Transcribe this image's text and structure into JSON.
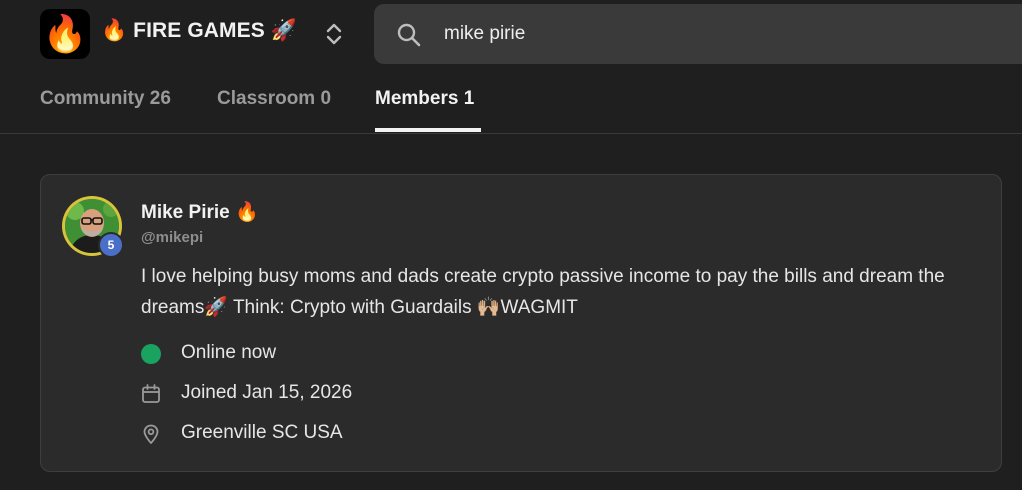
{
  "header": {
    "logo_emoji": "🔥",
    "group_name": "🔥 FIRE GAMES 🚀",
    "switcher_icon": "chevron-up-down-icon"
  },
  "search": {
    "value": "mike pirie",
    "icon": "search-icon"
  },
  "tabs": [
    {
      "label": "Community 26",
      "active": false
    },
    {
      "label": "Classroom 0",
      "active": false
    },
    {
      "label": "Members 1",
      "active": true
    }
  ],
  "member": {
    "name": "Mike Pirie 🔥",
    "handle": "@mikepi",
    "level": "5",
    "bio": "I love helping busy moms and dads create crypto passive income to pay the bills and dream the dreams🚀 Think: Crypto with Guardails 🙌🏼WAGMIT",
    "status": "Online now",
    "joined": "Joined Jan 15, 2026",
    "location": "Greenville SC USA"
  },
  "colors": {
    "background": "#1f1f1f",
    "card": "#2b2b2b",
    "online": "#1aa260",
    "level_badge": "#4a6fc7",
    "avatar_ring": "#d8c33a"
  }
}
